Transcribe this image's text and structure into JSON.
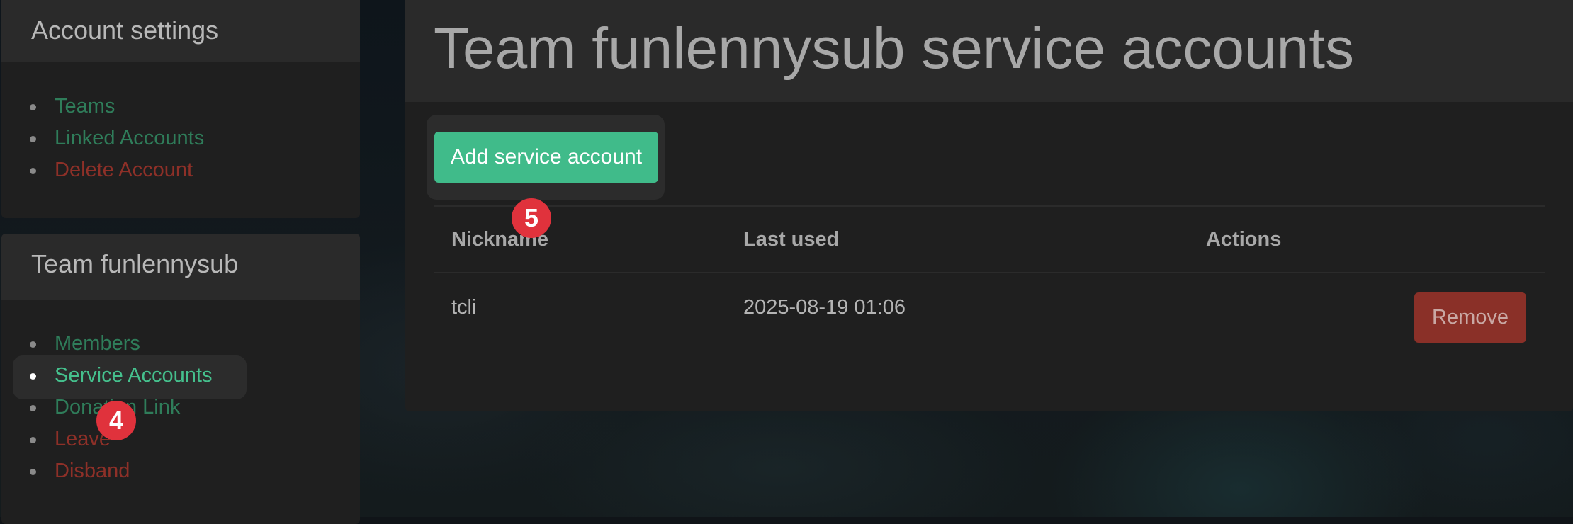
{
  "account_settings": {
    "title": "Account settings",
    "items": [
      {
        "label": "Teams",
        "color": "#2f7d5a"
      },
      {
        "label": "Linked Accounts",
        "color": "#2f7d5a"
      },
      {
        "label": "Delete Account",
        "color": "#8e3028"
      }
    ]
  },
  "team_nav": {
    "title": "Team funlennysub",
    "items": [
      {
        "label": "Members",
        "active": false
      },
      {
        "label": "Service Accounts",
        "active": true
      },
      {
        "label": "Donation Link",
        "active": false
      },
      {
        "label": "Leave",
        "active": false
      },
      {
        "label": "Disband",
        "active": false
      }
    ]
  },
  "main": {
    "title": "Team funlennysub service accounts",
    "add_button_label": "Add service account",
    "table": {
      "columns": [
        "Nickname",
        "Last used",
        "Actions"
      ],
      "rows": [
        {
          "nickname": "tcli",
          "last_used": "2025-08-19 01:06",
          "action_label": "Remove"
        }
      ]
    }
  },
  "annotations": {
    "badge_4": "4",
    "badge_5": "5"
  },
  "colors": {
    "accent_green": "#40bb8a",
    "link_green": "#2f7d5a",
    "danger_red": "#8a3028",
    "badge_red": "#e0323c"
  }
}
